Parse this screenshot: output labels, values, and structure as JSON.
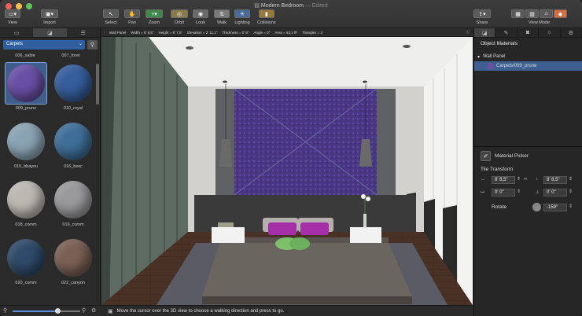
{
  "window": {
    "title": "Modern Bedroom",
    "title_suffix": "— Edited"
  },
  "toolbar": {
    "view_label": "View",
    "import_label": "Import",
    "select_label": "Select",
    "pan_label": "Pan",
    "zoom_label": "Zoom",
    "orbit_label": "Orbit",
    "look_label": "Look",
    "walk_label": "Walk",
    "lighting_label": "Lighting",
    "collisions_label": "Collisions",
    "share_label": "Share",
    "viewmode_label": "View Mode"
  },
  "library": {
    "category": "Carpets",
    "top_labels": [
      "006_sable",
      "007_foret"
    ],
    "items": [
      {
        "label": "009_prune",
        "color": "#6a4fa6",
        "selected": true
      },
      {
        "label": "010_royal",
        "color": "#355e9c"
      },
      {
        "label": "015_bbayou",
        "color": "#8aa3b3"
      },
      {
        "label": "016_bsec",
        "color": "#3f6f99"
      },
      {
        "label": "018_comm",
        "color": "#bdb8b2"
      },
      {
        "label": "019_comm",
        "color": "#9a9a9c"
      },
      {
        "label": "020_comm",
        "color": "#2f4a6a"
      },
      {
        "label": "022_canyon",
        "color": "#7a6055"
      }
    ],
    "zoom_level": 0.66
  },
  "infobar": {
    "object": "Wall Panel",
    "width": "Width = 8' 8,5\"",
    "height": "Height = 8' 7,5\"",
    "elevation": "Elevation = 2' 11,1\"",
    "thickness": "Thickness = 0' 8\"",
    "angle": "Angle = 0°",
    "area": "Area = 63,1 ft²",
    "triangles": "Triangles = 3"
  },
  "status": {
    "text": "Move the cursor over the 3D view to choose a walking direction and press to go."
  },
  "inspector": {
    "header": "Object Materials",
    "group": "Wall Panel",
    "material": "Carpets/009_prune",
    "material_picker": "Material Picker",
    "tile_transform": "Tile Transform",
    "width": "8' 8,5\"",
    "height": "8' 8,5\"",
    "offset_x": "0' 0\"",
    "offset_y": "0' 0\"",
    "rotate_label": "Rotate",
    "rotate_value": "-159°"
  },
  "colors": {
    "accent": "#2f5f9e",
    "panel_purple": "#4c3a86"
  }
}
